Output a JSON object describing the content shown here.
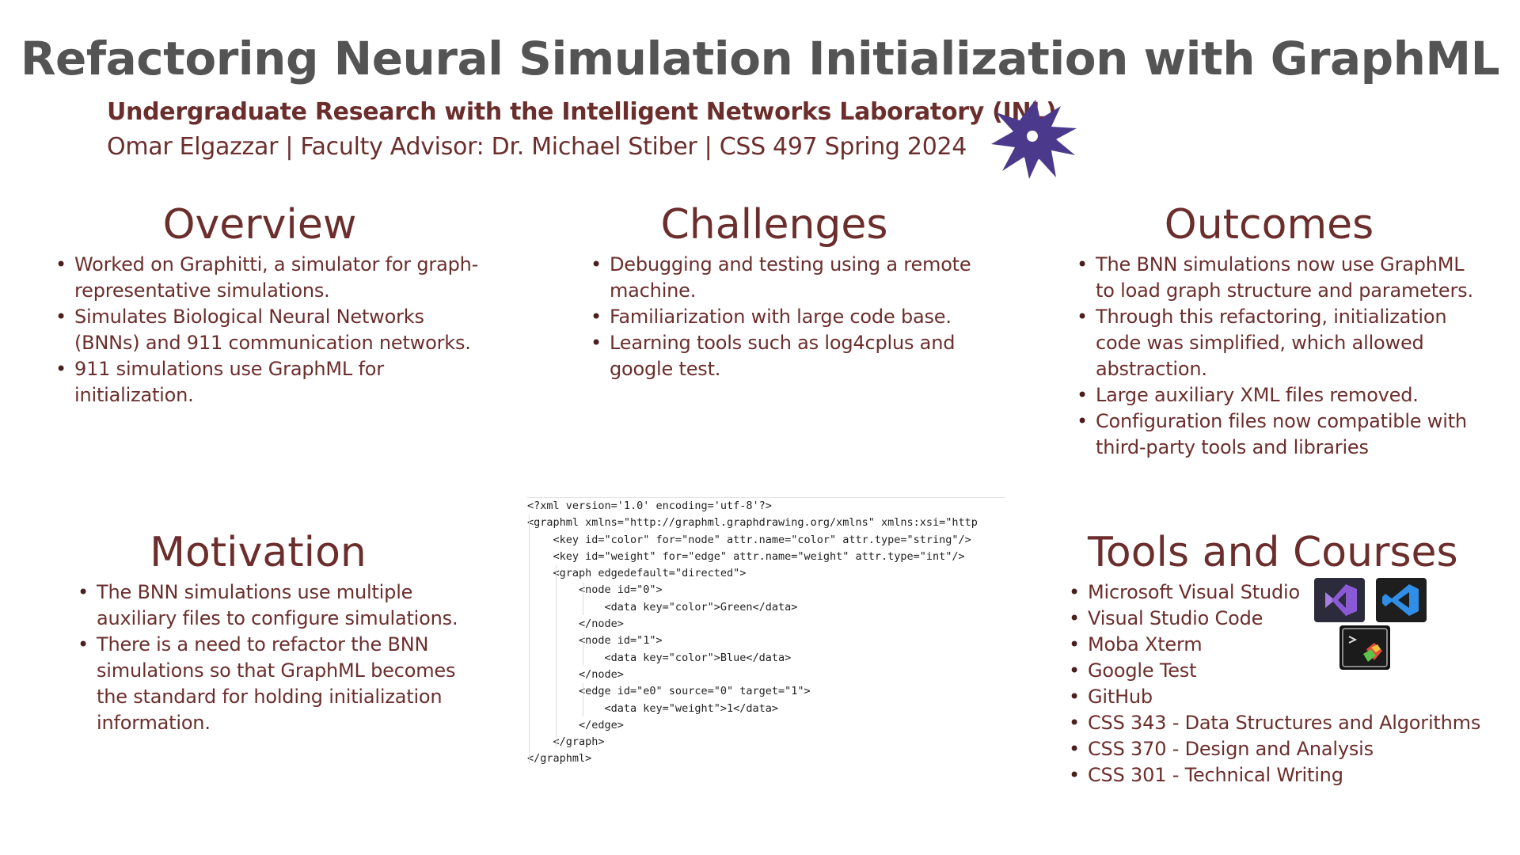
{
  "title": "Refactoring Neural Simulation Initialization with GraphML",
  "subtitle": "Undergraduate Research with the Intelligent Networks Laboratory (INL)",
  "byline": "Omar Elgazzar | Faculty Advisor: Dr. Michael Stiber | CSS 497 Spring 2024",
  "colors": {
    "heading": "#545454",
    "accent": "#6b2e2c",
    "logo": "#4b3a8c"
  },
  "overview": {
    "heading": "Overview",
    "items": [
      "Worked on Graphitti, a simulator for graph-representative simulations.",
      "Simulates Biological Neural Networks (BNNs) and 911 communication networks.",
      "911 simulations use GraphML for initialization."
    ]
  },
  "challenges": {
    "heading": "Challenges",
    "items": [
      "Debugging and testing using a remote machine.",
      "Familiarization with large code base.",
      "Learning tools such as log4cplus and google test."
    ]
  },
  "outcomes": {
    "heading": "Outcomes",
    "items": [
      "The BNN simulations now use GraphML to load graph structure and parameters.",
      "Through this refactoring, initialization code was simplified, which allowed abstraction.",
      "Large auxiliary XML files removed.",
      "Configuration files now compatible with third-party tools and libraries"
    ]
  },
  "motivation": {
    "heading": "Motivation",
    "items": [
      "The BNN simulations use multiple auxiliary files to configure simulations.",
      "There is a need to refactor the BNN simulations so that GraphML becomes the standard for holding initialization information."
    ]
  },
  "tools": {
    "heading": "Tools and Courses",
    "items": [
      "Microsoft Visual Studio",
      "Visual Studio Code",
      "Moba Xterm",
      "Google Test",
      "GitHub",
      "CSS 343 - Data Structures and Algorithms",
      "CSS 370 - Design and Analysis",
      "CSS 301 - Technical Writing"
    ],
    "icons": [
      "visual-studio-icon",
      "vscode-icon",
      "mobaxterm-icon"
    ]
  },
  "code": {
    "lines": [
      "<?xml version='1.0' encoding='utf-8'?>",
      "<graphml xmlns=\"http://graphml.graphdrawing.org/xmlns\" xmlns:xsi=\"http",
      "    <key id=\"color\" for=\"node\" attr.name=\"color\" attr.type=\"string\"/>",
      "    <key id=\"weight\" for=\"edge\" attr.name=\"weight\" attr.type=\"int\"/>",
      "    <graph edgedefault=\"directed\">",
      "        <node id=\"0\">",
      "            <data key=\"color\">Green</data>",
      "        </node>",
      "        <node id=\"1\">",
      "            <data key=\"color\">Blue</data>",
      "        </node>",
      "        <edge id=\"e0\" source=\"0\" target=\"1\">",
      "            <data key=\"weight\">1</data>",
      "        </edge>",
      "    </graph>",
      "</graphml>"
    ]
  }
}
